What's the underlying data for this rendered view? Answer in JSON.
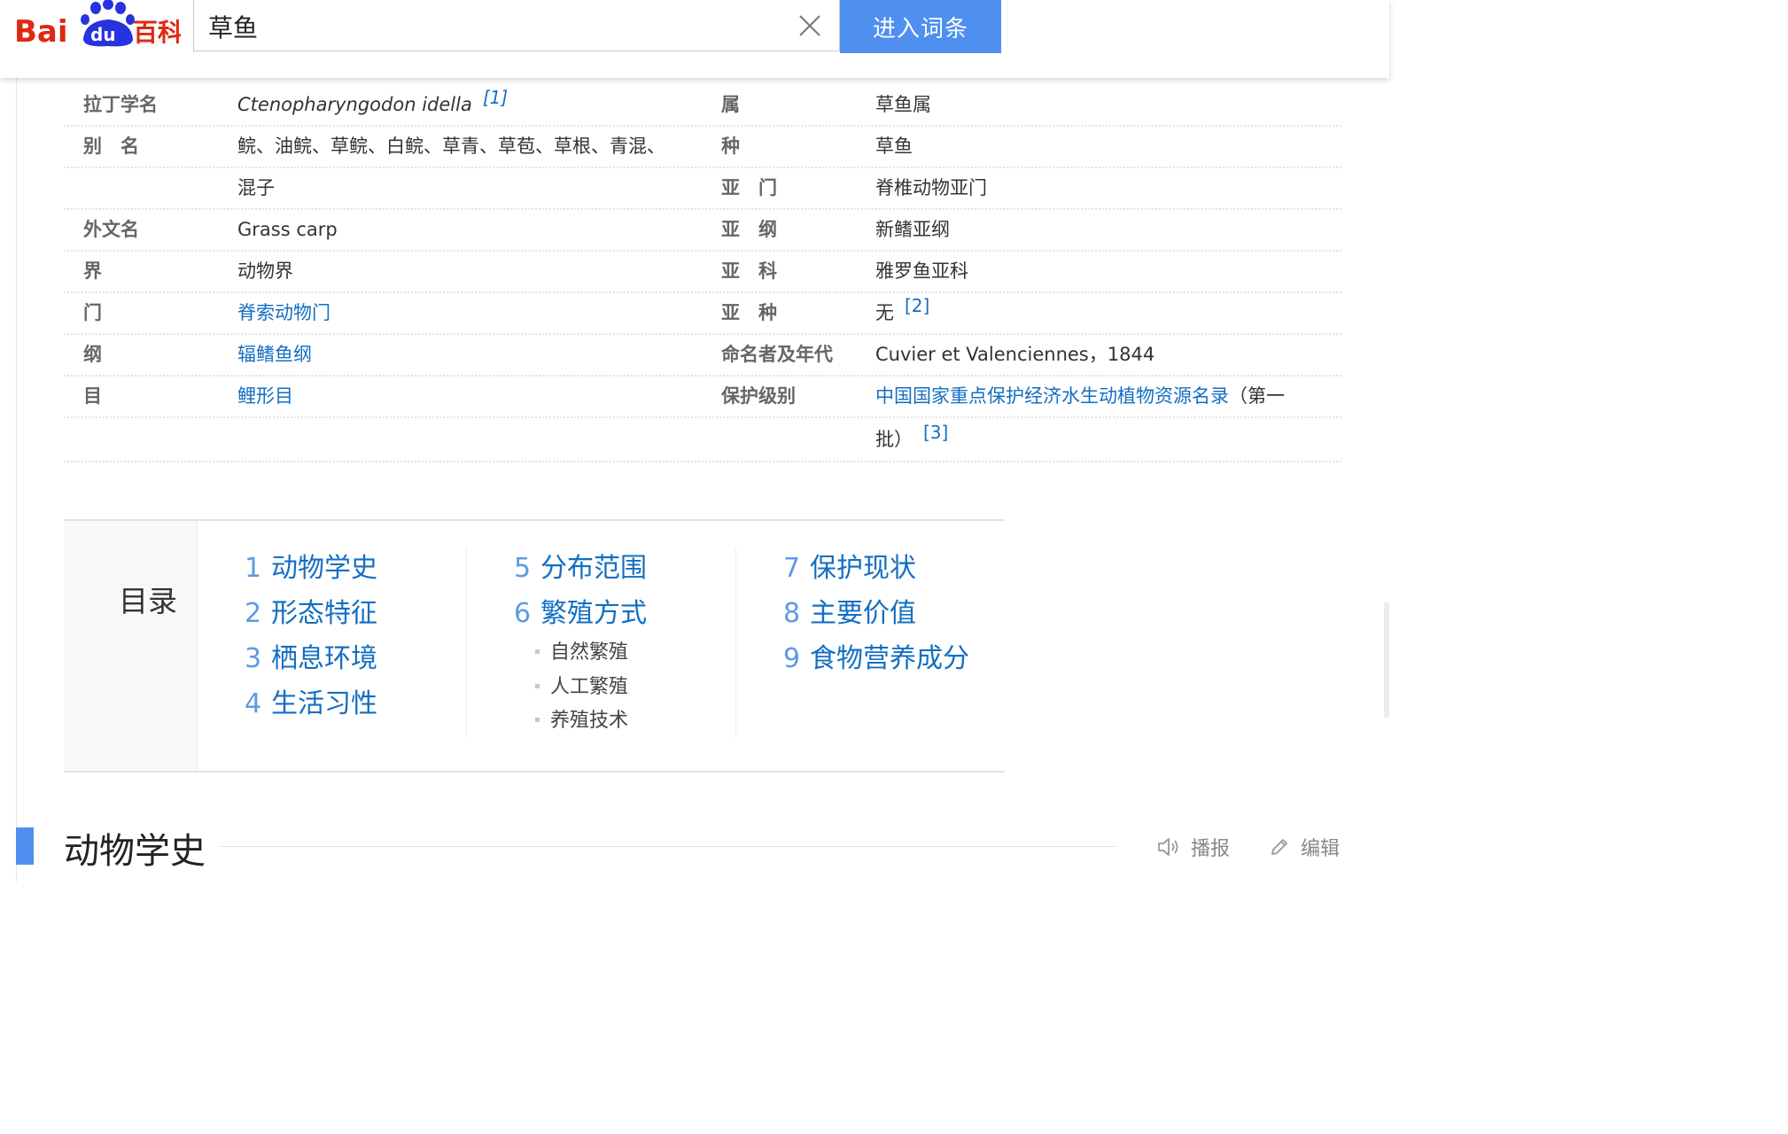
{
  "header": {
    "logo_text": "Bai du 百科",
    "search_value": "草鱼",
    "enter_label": "进入词条"
  },
  "info_rows": [
    {
      "label_l": "拉丁学名",
      "value_l": "Ctenopharyngodon idella",
      "value_l_ref": "[1]",
      "label_r": "属",
      "value_r": "草鱼属",
      "link_r": true
    },
    {
      "label_l": "别　名",
      "value_l": "鲩、油鲩、草鲩、白鲩、草青、草苞、草根、青混、",
      "label_r": "种",
      "value_r": "草鱼",
      "link_r": false
    },
    {
      "label_l": "",
      "value_l": "混子",
      "label_r": "亚　门",
      "value_r": "脊椎动物亚门",
      "link_r": true
    },
    {
      "label_l": "外文名",
      "value_l": "Grass carp",
      "label_r": "亚　纲",
      "value_r": "新鳍亚纲",
      "link_r": true
    },
    {
      "label_l": "界",
      "value_l": "动物界",
      "label_r": "亚　科",
      "value_r": "雅罗鱼亚科",
      "link_r": true
    },
    {
      "label_l": "门",
      "value_l": "脊索动物门",
      "link_l": true,
      "label_r": "亚　种",
      "value_r": "无",
      "value_r_ref": "[2]",
      "link_r": false
    },
    {
      "label_l": "纲",
      "value_l": "辐鳍鱼纲",
      "link_l": true,
      "label_r": "命名者及年代",
      "value_r": "Cuvier et Valenciennes，1844",
      "link_r": false
    },
    {
      "label_l": "目",
      "value_l": "鲤形目",
      "link_l": true,
      "label_r": "保护级别",
      "value_r": "中国国家重点保护经济水生动植物资源名录（第一",
      "value_r_link_part": "中国国家重点保护经济水生动植物资源名录",
      "value_r_rest": "（第一",
      "link_r": true
    },
    {
      "label_l": "",
      "value_l": "",
      "label_r": "",
      "value_r": "批）",
      "value_r_ref": "[3]",
      "link_r": false
    }
  ],
  "catalog": {
    "title": "目录",
    "items": [
      {
        "num": "1",
        "text": "动物学史"
      },
      {
        "num": "2",
        "text": "形态特征"
      },
      {
        "num": "3",
        "text": "栖息环境"
      },
      {
        "num": "4",
        "text": "生活习性"
      },
      {
        "num": "5",
        "text": "分布范围"
      },
      {
        "num": "6",
        "text": "繁殖方式"
      },
      {
        "num": "7",
        "text": "保护现状"
      },
      {
        "num": "8",
        "text": "主要价值"
      },
      {
        "num": "9",
        "text": "食物营养成分"
      }
    ],
    "sub_items": [
      "自然繁殖",
      "人工繁殖",
      "养殖技术"
    ]
  },
  "section": {
    "title": "动物学史",
    "play_label": "播报",
    "edit_label": "编辑"
  },
  "colors": {
    "link": "#136ec2",
    "accent": "#4e8ff0",
    "baidu_red": "#de2910",
    "baidu_blue": "#2932e1"
  }
}
